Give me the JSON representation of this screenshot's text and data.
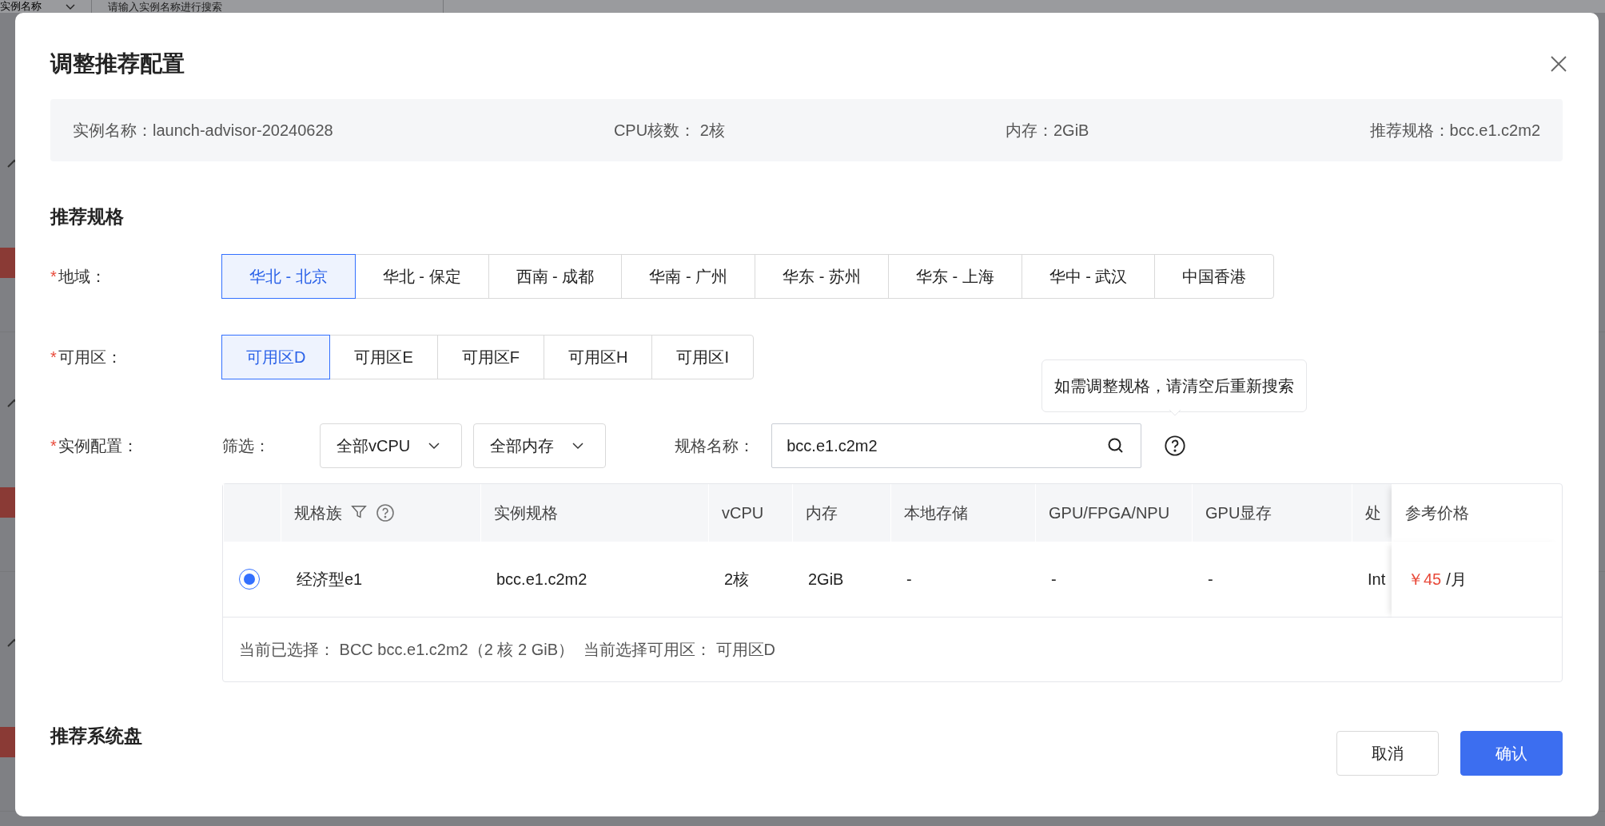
{
  "background": {
    "filter_select": "实例名称",
    "search_placeholder": "请输入实例名称进行搜索",
    "rows": [
      {
        "kind": "tagged"
      },
      {
        "kind": "tagged"
      },
      {
        "kind": "tagged"
      }
    ]
  },
  "dialog": {
    "title": "调整推荐配置",
    "summary": [
      "实例名称：launch-advisor-20240628",
      "CPU核数： 2核",
      "内存：2GiB",
      "推荐规格：bcc.e1.c2m2"
    ],
    "spec_heading": "推荐规格",
    "region": {
      "required_mark": "*",
      "label": "地域：",
      "options": [
        {
          "label": "华北 - 北京",
          "selected": true
        },
        {
          "label": "华北 - 保定",
          "selected": false
        },
        {
          "label": "西南 - 成都",
          "selected": false
        },
        {
          "label": "华南 - 广州",
          "selected": false
        },
        {
          "label": "华东 - 苏州",
          "selected": false
        },
        {
          "label": "华东 - 上海",
          "selected": false
        },
        {
          "label": "华中 - 武汉",
          "selected": false
        },
        {
          "label": "中国香港",
          "selected": false
        }
      ]
    },
    "zone": {
      "required_mark": "*",
      "label": "可用区：",
      "options": [
        {
          "label": "可用区D",
          "selected": true
        },
        {
          "label": "可用区E",
          "selected": false
        },
        {
          "label": "可用区F",
          "selected": false
        },
        {
          "label": "可用区H",
          "selected": false
        },
        {
          "label": "可用区I",
          "selected": false
        }
      ]
    },
    "instance_config": {
      "required_mark": "*",
      "label": "实例配置：",
      "filter_label": "筛选：",
      "dropdowns": [
        "全部vCPU",
        "全部内存"
      ],
      "name_label": "规格名称：",
      "name_value": "bcc.e1.c2m2",
      "tooltip": "如需调整规格，请清空后重新搜索"
    },
    "table": {
      "columns": [
        {
          "label": "规格族",
          "kind": "filterable"
        },
        {
          "label": "实例规格",
          "kind": "plain"
        },
        {
          "label": "vCPU",
          "kind": "plain"
        },
        {
          "label": "内存",
          "kind": "plain"
        },
        {
          "label": "本地存储",
          "kind": "plain"
        },
        {
          "label": "GPU/FPGA/NPU",
          "kind": "plain"
        },
        {
          "label": "GPU显存",
          "kind": "plain"
        },
        {
          "label": "处",
          "kind": "plain"
        },
        {
          "label": "参考价格",
          "kind": "pinned"
        }
      ],
      "rows": [
        {
          "selected": true,
          "cells": [
            "经济型e1",
            "bcc.e1.c2m2",
            "2核",
            "2GiB",
            "-",
            "-",
            "-",
            "Int"
          ],
          "price": "￥45",
          "price_unit": "/月"
        }
      ],
      "footer": [
        "当前已选择： BCC bcc.e1.c2m2（2 核 2 GiB）",
        "当前选择可用区： 可用区D"
      ]
    },
    "disk_heading": "推荐系统盘",
    "buttons": [
      {
        "label": "取消",
        "kind": "secondary"
      },
      {
        "label": "确认",
        "kind": "primary"
      }
    ]
  }
}
